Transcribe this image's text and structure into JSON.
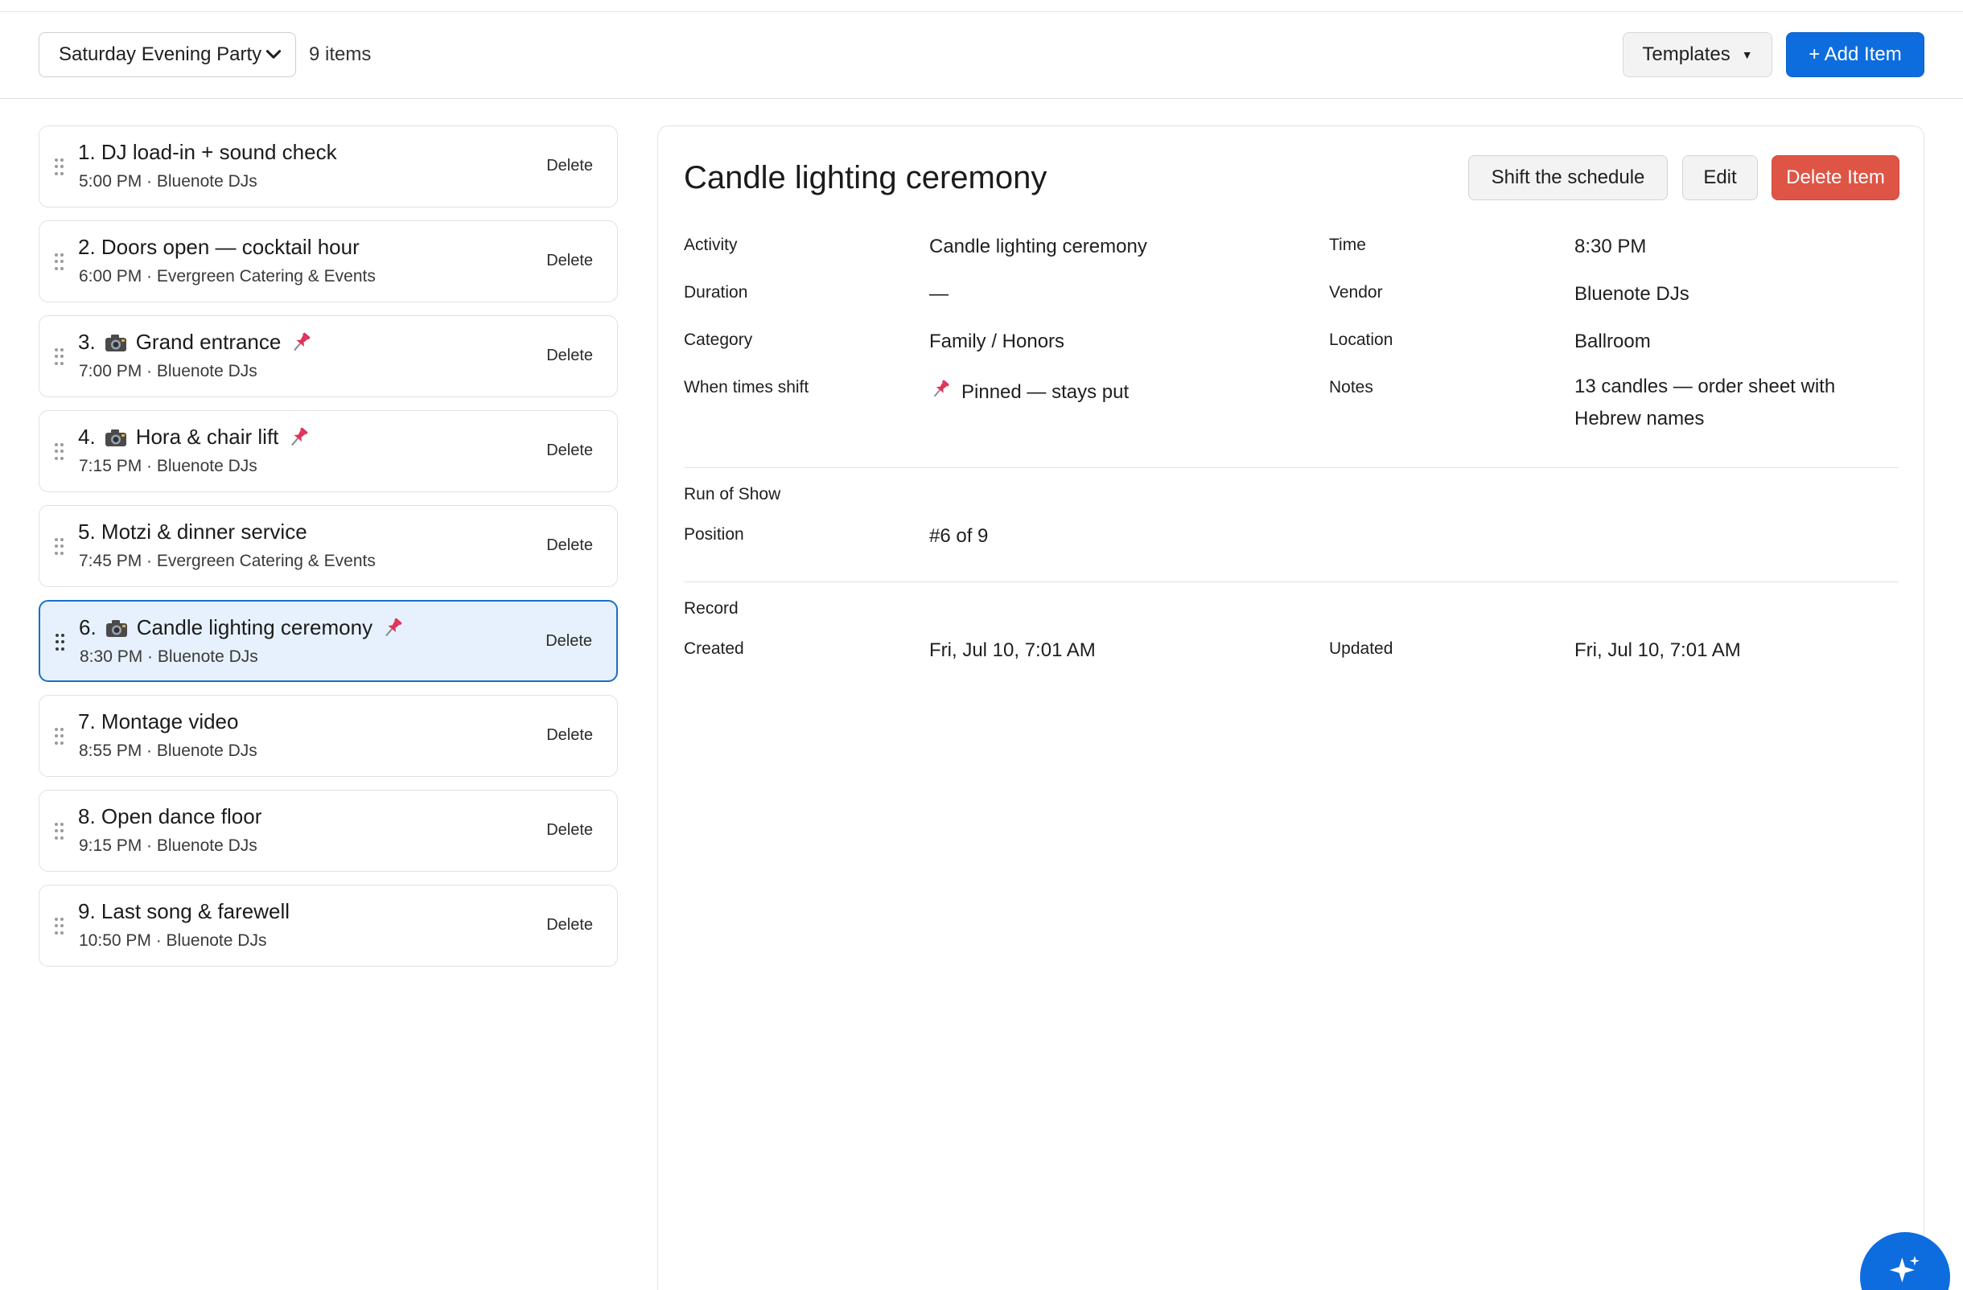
{
  "toolbar": {
    "schedule_selected": "Saturday Evening Party",
    "item_count": "9 items",
    "templates_label": "Templates",
    "add_item_label": "+ Add Item"
  },
  "list": {
    "delete_label": "Delete",
    "items": [
      {
        "title": "1. DJ load-in + sound check",
        "sub": "5:00 PM · Bluenote DJs",
        "camera": false,
        "pinned": false,
        "selected": false
      },
      {
        "title": "2. Doors open — cocktail hour",
        "sub": "6:00 PM · Evergreen Catering & Events",
        "camera": false,
        "pinned": false,
        "selected": false
      },
      {
        "title": "3.",
        "title2": "Grand entrance",
        "sub": "7:00 PM · Bluenote DJs",
        "camera": true,
        "pinned": true,
        "selected": false
      },
      {
        "title": "4.",
        "title2": "Hora & chair lift",
        "sub": "7:15 PM · Bluenote DJs",
        "camera": true,
        "pinned": true,
        "selected": false
      },
      {
        "title": "5. Motzi & dinner service",
        "sub": "7:45 PM · Evergreen Catering & Events",
        "camera": false,
        "pinned": false,
        "selected": false
      },
      {
        "title": "6.",
        "title2": "Candle lighting ceremony",
        "sub": "8:30 PM · Bluenote DJs",
        "camera": true,
        "pinned": true,
        "selected": true
      },
      {
        "title": "7. Montage video",
        "sub": "8:55 PM · Bluenote DJs",
        "camera": false,
        "pinned": false,
        "selected": false
      },
      {
        "title": "8. Open dance floor",
        "sub": "9:15 PM · Bluenote DJs",
        "camera": false,
        "pinned": false,
        "selected": false
      },
      {
        "title": "9. Last song & farewell",
        "sub": "10:50 PM · Bluenote DJs",
        "camera": false,
        "pinned": false,
        "selected": false
      }
    ]
  },
  "detail": {
    "title": "Candle lighting ceremony",
    "shift_label": "Shift the schedule",
    "edit_label": "Edit",
    "delete_label": "Delete Item",
    "fields": {
      "activity_label": "Activity",
      "activity": "Candle lighting ceremony",
      "time_label": "Time",
      "time": "8:30 PM",
      "duration_label": "Duration",
      "duration": "—",
      "vendor_label": "Vendor",
      "vendor": "Bluenote DJs",
      "category_label": "Category",
      "category": "Family / Honors",
      "location_label": "Location",
      "location": "Ballroom",
      "shift_label": "When times shift",
      "shift": "Pinned — stays put",
      "notes_label": "Notes",
      "notes": "13 candles — order sheet with Hebrew names"
    },
    "run_of_show": {
      "section": "Run of Show",
      "position_label": "Position",
      "position": "#6 of 9"
    },
    "record": {
      "section": "Record",
      "created_label": "Created",
      "created": "Fri, Jul 10, 7:01 AM",
      "updated_label": "Updated",
      "updated": "Fri, Jul 10, 7:01 AM"
    }
  },
  "icons": {
    "camera": "camera-icon",
    "pin": "pushpin-icon",
    "drag": "drag-handle-icon",
    "assistant": "sparkle-icon"
  },
  "colors": {
    "primary": "#0d6ddf",
    "danger": "#de5545",
    "selected_bg": "#e6f1fd",
    "selected_border": "#1a6fc9",
    "pin": "#e0335a"
  }
}
